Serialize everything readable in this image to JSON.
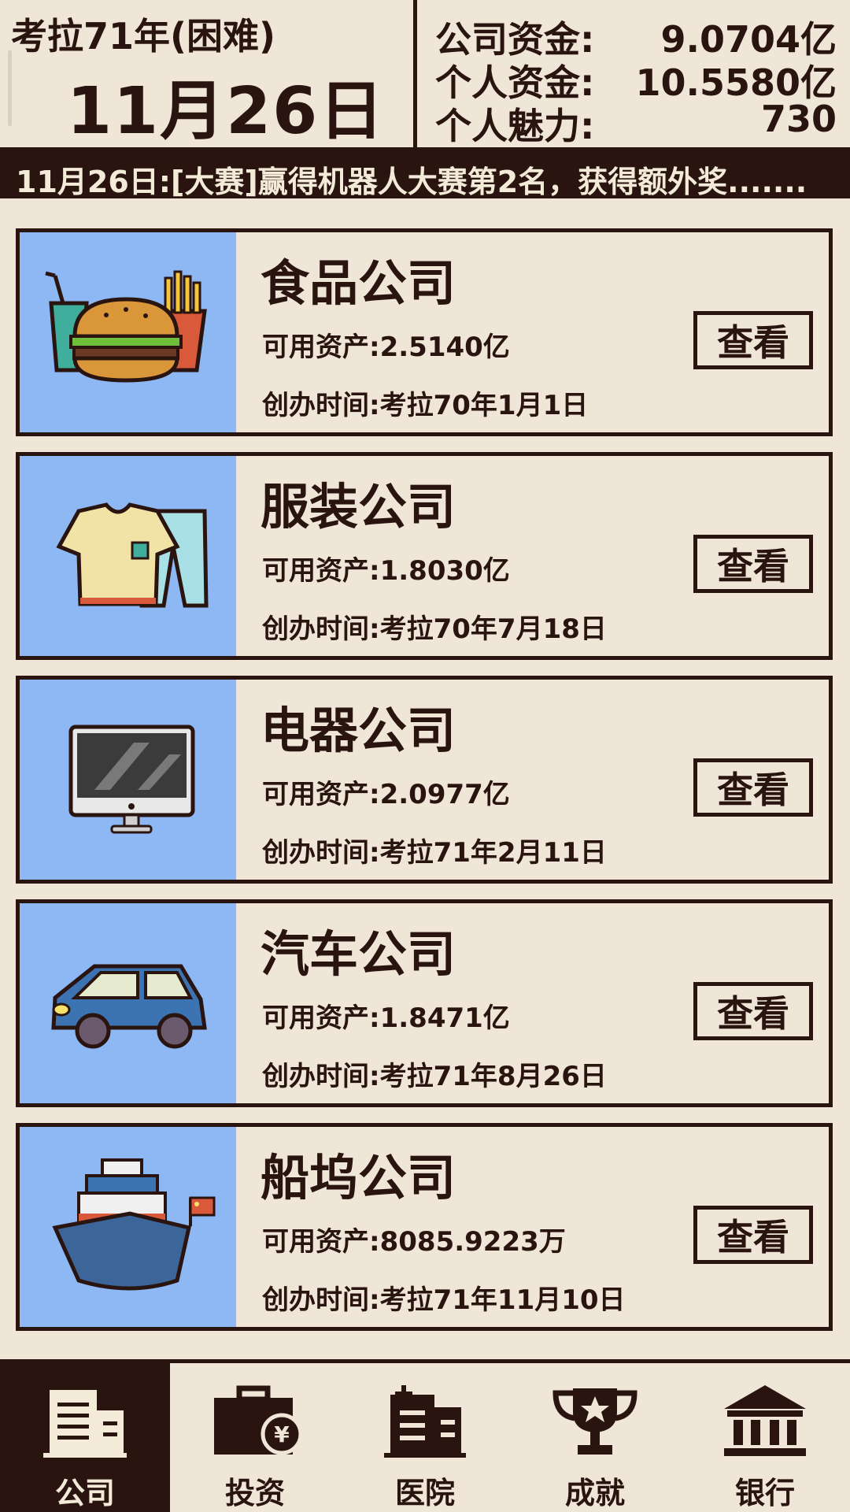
{
  "header": {
    "year_label": "考拉71年(困难)",
    "date_label": "11月26日",
    "stats": [
      {
        "label": "公司资金:",
        "value": "9.0704亿"
      },
      {
        "label": "个人资金:",
        "value": "10.5580亿"
      },
      {
        "label": "个人魅力:",
        "value": "730"
      }
    ]
  },
  "ticker": {
    "text": "11月26日:[大赛]赢得机器人大赛第2名，获得额外奖......."
  },
  "companies": [
    {
      "name": "食品公司",
      "assets": "可用资产:2.5140亿",
      "founded": "创办时间:考拉70年1月1日",
      "button": "查看",
      "icon": "burger-fries-icon"
    },
    {
      "name": "服装公司",
      "assets": "可用资产:1.8030亿",
      "founded": "创办时间:考拉70年7月18日",
      "button": "查看",
      "icon": "tshirt-pants-icon"
    },
    {
      "name": "电器公司",
      "assets": "可用资产:2.0977亿",
      "founded": "创办时间:考拉71年2月11日",
      "button": "查看",
      "icon": "monitor-icon"
    },
    {
      "name": "汽车公司",
      "assets": "可用资产:1.8471亿",
      "founded": "创办时间:考拉71年8月26日",
      "button": "查看",
      "icon": "car-icon"
    },
    {
      "name": "船坞公司",
      "assets": "可用资产:8085.9223万",
      "founded": "创办时间:考拉71年11月10日",
      "button": "查看",
      "icon": "ship-icon"
    }
  ],
  "nav": [
    {
      "label": "公司",
      "icon": "office-building-icon",
      "active": true
    },
    {
      "label": "投资",
      "icon": "briefcase-yen-icon",
      "active": false
    },
    {
      "label": "医院",
      "icon": "hospital-icon",
      "active": false
    },
    {
      "label": "成就",
      "icon": "trophy-icon",
      "active": false
    },
    {
      "label": "银行",
      "icon": "bank-icon",
      "active": false
    }
  ],
  "colors": {
    "background": "#efe6d8",
    "ink": "#2a1410",
    "thumb_bg": "#8db8f3"
  }
}
